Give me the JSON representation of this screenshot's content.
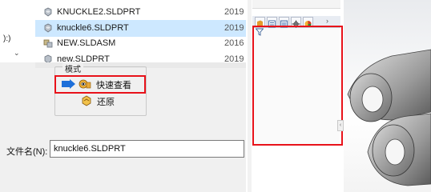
{
  "dialog": {
    "nav_label": "):)",
    "nav_chevron": "⌄",
    "files": [
      {
        "name": "KNUCKLE2.SLDPRT",
        "date": "2019",
        "type": "part",
        "selected": false
      },
      {
        "name": "knuckle6.SLDPRT",
        "date": "2019",
        "type": "part",
        "selected": true
      },
      {
        "name": "NEW.SLDASM",
        "date": "2016",
        "type": "assembly",
        "selected": false
      },
      {
        "name": "new.SLDPRT",
        "date": "2019",
        "type": "part",
        "selected": false
      }
    ],
    "mode": {
      "title": "模式",
      "quick_view": "快速查看",
      "restore": "还原"
    },
    "filename_label": "文件名(N):",
    "filename_value": "knuckle6.SLDPRT"
  },
  "solidworks": {
    "panel_tabs": [
      "feature-manager",
      "property-manager",
      "configuration-manager",
      "dimxpert",
      "display-manager"
    ],
    "filter_icon": "funnel-icon",
    "collapse_icon": "‹"
  },
  "colors": {
    "highlight": "#e8121a",
    "selection": "#cde8ff",
    "accent_arrow": "#1e6fd9"
  }
}
